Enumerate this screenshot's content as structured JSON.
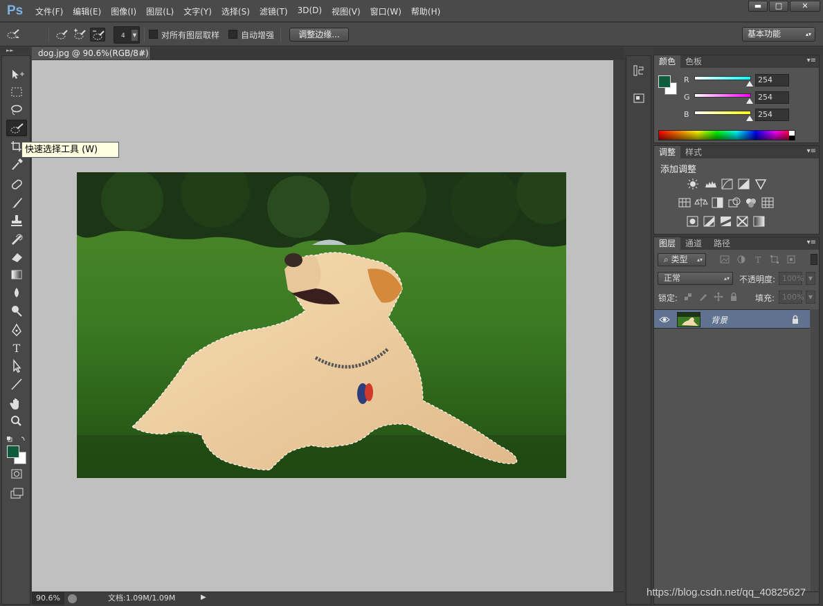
{
  "app": {
    "logo": "Ps"
  },
  "menu": [
    "文件(F)",
    "编辑(E)",
    "图像(I)",
    "图层(L)",
    "文字(Y)",
    "选择(S)",
    "滤镜(T)",
    "3D(D)",
    "视图(V)",
    "窗口(W)",
    "帮助(H)"
  ],
  "window_controls": {
    "minimize": "▬",
    "maximize": "□",
    "close": "✕"
  },
  "options": {
    "brush_size": "4",
    "sample_all_layers": "对所有图层取样",
    "auto_enhance": "自动增强",
    "refine_edge": "调整边缘...",
    "workspace": "基本功能"
  },
  "tooltip": "快速选择工具 (W)",
  "document": {
    "tab_title": "dog.jpg @ 90.6%(RGB/8#)",
    "tab_close": "×",
    "zoom": "90.6%",
    "doc_info": "文档:1.09M/1.09M"
  },
  "color_panel": {
    "tabs": [
      "颜色",
      "色板"
    ],
    "channels": [
      {
        "label": "R",
        "value": "254",
        "gradient": [
          "#ffffff",
          "#00ffff"
        ]
      },
      {
        "label": "G",
        "value": "254",
        "gradient": [
          "#ffffff",
          "#ff00ff"
        ]
      },
      {
        "label": "B",
        "value": "254",
        "gradient": [
          "#ffffff",
          "#ffff00"
        ]
      }
    ],
    "foreground": "#0f5c3d",
    "background": "#ffffff"
  },
  "adjust_panel": {
    "tabs": [
      "调整",
      "样式"
    ],
    "title": "添加调整"
  },
  "layers_panel": {
    "tabs": [
      "图层",
      "通道",
      "路径"
    ],
    "kind_filter": "类型",
    "blend_mode": "正常",
    "opacity_label": "不透明度:",
    "opacity_value": "100%",
    "lock_label": "锁定:",
    "fill_label": "填充:",
    "fill_value": "100%",
    "layer_name": "背景"
  },
  "watermark": "https://blog.csdn.net/qq_40825627"
}
